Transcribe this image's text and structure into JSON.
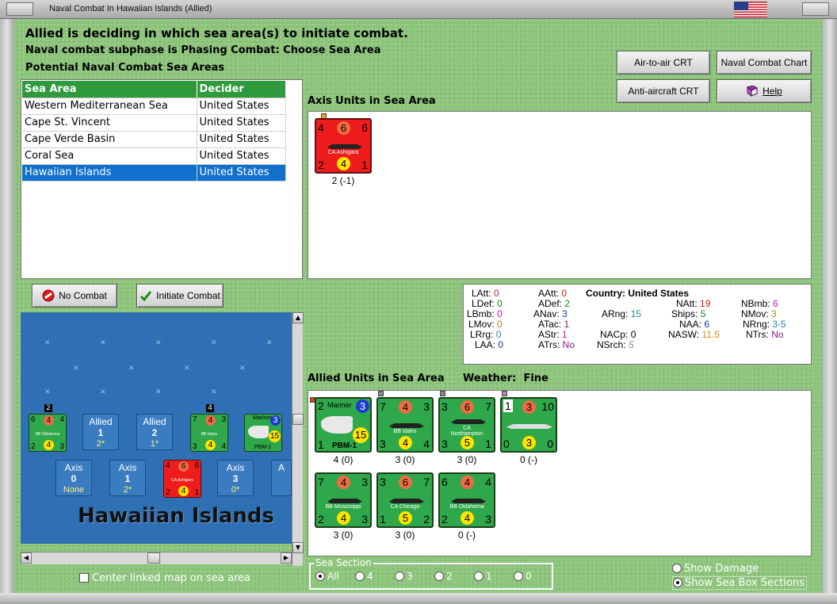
{
  "window": {
    "title": "Naval Combat In Hawaiian Islands (Allied)"
  },
  "header": {
    "line1": "Allied is deciding in which sea area(s) to initiate combat.",
    "line2": "Naval combat subphase is Phasing Combat: Choose Sea Area",
    "line3": "Potential Naval Combat Sea Areas"
  },
  "buttons": {
    "air_to_air": "Air-to-air CRT",
    "naval_chart": "Naval Combat Chart",
    "anti_aircraft": "Anti-aircraft CRT",
    "help": "Help",
    "no_combat": "No Combat",
    "initiate": "Initiate Combat"
  },
  "sea_table": {
    "headers": [
      "Sea Area",
      "Decider"
    ],
    "rows": [
      [
        "Western Mediterranean Sea",
        "United States"
      ],
      [
        "Cape St. Vincent",
        "United States"
      ],
      [
        "Cape Verde Basin",
        "United States"
      ],
      [
        "Coral Sea",
        "United States"
      ],
      [
        "Hawaiian Islands",
        "United States"
      ]
    ],
    "selected_index": 4
  },
  "axis_panel": {
    "title": "Axis Units in Sea Area",
    "units": [
      {
        "name": "CA Ashigara",
        "tl": "4",
        "att": "6",
        "tr": "6",
        "bl": "2",
        "def": "4",
        "br": "1",
        "caption": "2 (-1)"
      }
    ]
  },
  "stats": {
    "country_label": "Country:",
    "country": "United States",
    "rows": [
      [
        "LAtt:",
        "0",
        "AAtt:",
        "0"
      ],
      [
        "LDef:",
        "0",
        "ADef:",
        "2"
      ],
      [
        "LBmb:",
        "0",
        "ANav:",
        "3",
        "ARng:",
        "15"
      ],
      [
        "LMov:",
        "0",
        "ATac:",
        "1"
      ],
      [
        "LRrg:",
        "0",
        "AStr:",
        "1",
        "NACp:",
        "0"
      ],
      [
        "LAA:",
        "0",
        "ATrs:",
        "No",
        "NSrch:",
        "5"
      ]
    ],
    "naval": [
      [
        "NAtt:",
        "19",
        "NBmb:",
        "6"
      ],
      [
        "Ships:",
        "5",
        "NMov:",
        "3"
      ],
      [
        "NAA:",
        "6",
        "NRng:",
        "3-5"
      ],
      [
        "NASW:",
        "11.5",
        "NTrs:",
        "No"
      ]
    ]
  },
  "allied_panel": {
    "title": "Allied Units in Sea Area",
    "weather_label": "Weather:",
    "weather": "Fine",
    "units": [
      {
        "name": "PBM-1",
        "top": "Mariner",
        "tl": "2",
        "att": "3",
        "bl": "1",
        "def": "15",
        "caption": "4 (0)"
      },
      {
        "name": "BB Idaho",
        "tl": "7",
        "att": "4",
        "tr": "3",
        "bl": "3",
        "def": "4",
        "br": "4",
        "caption": "3 (0)"
      },
      {
        "name": "CA Northampton",
        "tl": "3",
        "att": "6",
        "tr": "7",
        "bl": "3",
        "def": "5",
        "br": "1",
        "caption": "3 (0)"
      },
      {
        "name": "",
        "tl": "1",
        "att": "3",
        "tr": "10",
        "bl": "0",
        "def": "3",
        "br": "0",
        "caption": "0 (-)"
      },
      {
        "name": "BB Mississippi",
        "tl": "7",
        "att": "4",
        "tr": "3",
        "bl": "2",
        "def": "4",
        "br": "3",
        "caption": "3 (0)"
      },
      {
        "name": "CA Chicago",
        "tl": "3",
        "att": "6",
        "tr": "7",
        "bl": "1",
        "def": "5",
        "br": "2",
        "caption": "3 (0)"
      },
      {
        "name": "BB Oklahoma",
        "tl": "6",
        "att": "4",
        "tr": "4",
        "bl": "2",
        "def": "4",
        "br": "3",
        "caption": "0 (-)"
      }
    ]
  },
  "map": {
    "area_name": "Hawaiian Islands",
    "allied_boxes": [
      {
        "label": "Allied",
        "num": "1",
        "val": "2*"
      },
      {
        "label": "Allied",
        "num": "2",
        "val": "1*"
      }
    ],
    "axis_boxes": [
      {
        "label": "Axis",
        "num": "0",
        "val": "None"
      },
      {
        "label": "Axis",
        "num": "1",
        "val": "2*"
      },
      {
        "label": "Axis",
        "num": "3",
        "val": "0*"
      },
      {
        "label": "A"
      }
    ],
    "stack_labels": [
      "2",
      "4"
    ],
    "map_counters": [
      {
        "name": "BB Oklahoma",
        "tl": "6",
        "att": "4",
        "tr": "4",
        "bl": "2",
        "def": "4",
        "br": "3"
      },
      {
        "name": "BB Idaho",
        "tl": "7",
        "att": "4",
        "tr": "3",
        "bl": "3",
        "def": "4",
        "br": "4"
      },
      {
        "name": "PBM-1",
        "top": "Mariner",
        "att": "3",
        "def": "15"
      },
      {
        "name": "CA Ashigara",
        "tl": "4",
        "att": "6",
        "tr": "6",
        "bl": "2",
        "def": "4",
        "br": "1"
      }
    ]
  },
  "footer": {
    "center_map": "Center linked map on sea area",
    "sea_section_label": "Sea Section",
    "sea_section_options": [
      "All",
      "4",
      "3",
      "2",
      "1",
      "0"
    ],
    "show_damage": "Show Damage",
    "show_sections": "Show Sea Box Sections"
  },
  "colors": {
    "background": "#8dc57b",
    "table_header": "#2f9a3d",
    "selected_row": "#1070cc",
    "allied_counter": "#2ea84a",
    "axis_counter": "#ee1c1c"
  }
}
